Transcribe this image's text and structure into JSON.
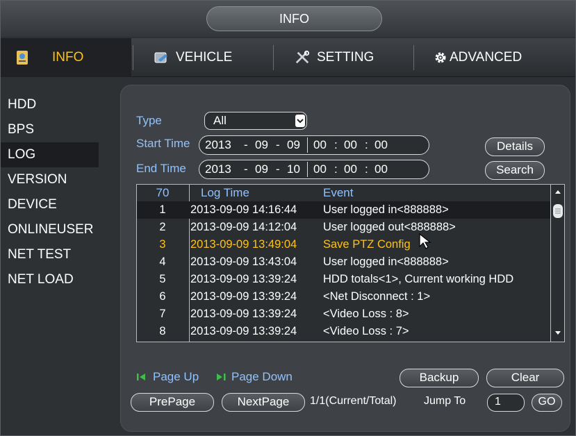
{
  "window": {
    "title": "INFO"
  },
  "tabs": [
    {
      "label": "INFO",
      "icon": "info-icon",
      "active": true
    },
    {
      "label": "VEHICLE",
      "icon": "vehicle-icon",
      "active": false
    },
    {
      "label": "SETTING",
      "icon": "setting-icon",
      "active": false
    },
    {
      "label": "ADVANCED",
      "icon": "advanced-gear-icon",
      "active": false
    }
  ],
  "sidebar": {
    "items": [
      {
        "label": "HDD"
      },
      {
        "label": "BPS"
      },
      {
        "label": "LOG",
        "active": true
      },
      {
        "label": "VERSION"
      },
      {
        "label": "DEVICE"
      },
      {
        "label": "ONLINEUSER"
      },
      {
        "label": "NET TEST"
      },
      {
        "label": "NET LOAD"
      }
    ]
  },
  "filter": {
    "type_label": "Type",
    "type_value": "All",
    "start_label": "Start Time",
    "start_year": "2013",
    "start_month": "09",
    "start_day": "09",
    "start_hh": "00",
    "start_mm": "00",
    "start_ss": "00",
    "end_label": "End Time",
    "end_year": "2013",
    "end_month": "09",
    "end_day": "10",
    "end_hh": "00",
    "end_mm": "00",
    "end_ss": "00",
    "date_sep": "-",
    "time_sep": ":",
    "details_label": "Details",
    "search_label": "Search"
  },
  "table": {
    "headers": {
      "count": "70",
      "time": "Log Time",
      "event": "Event"
    },
    "rows": [
      {
        "no": "1",
        "time": "2013-09-09 14:16:44",
        "event": "User logged in<888888>"
      },
      {
        "no": "2",
        "time": "2013-09-09 14:12:04",
        "event": "User logged out<888888>"
      },
      {
        "no": "3",
        "time": "2013-09-09 13:49:04",
        "event": "Save PTZ Config"
      },
      {
        "no": "4",
        "time": "2013-09-09 13:43:04",
        "event": "User logged in<888888>"
      },
      {
        "no": "5",
        "time": "2013-09-09 13:39:24",
        "event": "HDD totals<1>, Current working HDD"
      },
      {
        "no": "6",
        "time": "2013-09-09 13:39:24",
        "event": "<Net Disconnect : 1>"
      },
      {
        "no": "7",
        "time": "2013-09-09 13:39:24",
        "event": "<Video Loss : 8>"
      },
      {
        "no": "8",
        "time": "2013-09-09 13:39:24",
        "event": "<Video Loss : 7>"
      }
    ],
    "selected_row": 1,
    "highlighted_row": 3
  },
  "pager": {
    "page_up": "Page Up",
    "page_down": "Page Down",
    "backup": "Backup",
    "clear": "Clear",
    "prepage": "PrePage",
    "nextpage": "NextPage",
    "status": "1/1(Current/Total)",
    "jump_to": "Jump To",
    "jump_value": "1",
    "go": "GO"
  },
  "colors": {
    "accent": "#ffc21a",
    "label_blue": "#8fc2ff",
    "panel": "#3e4246"
  }
}
